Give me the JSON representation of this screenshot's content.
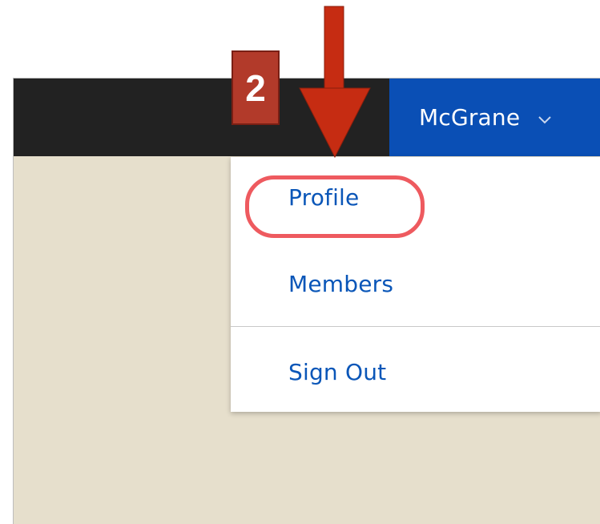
{
  "header": {
    "user_name": "McGrane",
    "user_chevron_icon": "chevron-down-icon",
    "bar_color": "#222222",
    "user_menu_color": "#0a4fb5"
  },
  "dropdown": {
    "items": [
      {
        "label": "Profile"
      },
      {
        "label": "Members"
      },
      {
        "label": "Sign Out"
      }
    ],
    "link_color": "#0a56b8"
  },
  "annotation": {
    "step_number": "2",
    "arrow_icon": "arrow-down-icon",
    "highlight_color": "#ee5a5f",
    "badge_color": "#b23a2a"
  },
  "page": {
    "background_color": "#e6dfcc"
  }
}
